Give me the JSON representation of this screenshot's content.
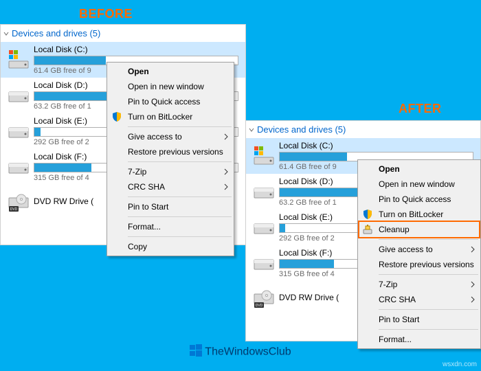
{
  "labels": {
    "before": "BEFORE",
    "after": "AFTER"
  },
  "section": {
    "title": "Devices and drives (5)"
  },
  "colors": {
    "accent": "#ff6a00",
    "link": "#0066cc",
    "bar": "#26a0da"
  },
  "drives_before": [
    {
      "name": "Local Disk (C:)",
      "free": "61.4 GB free of 9",
      "fill": 35,
      "type": "os",
      "selected": true
    },
    {
      "name": "Local Disk (D:)",
      "free": "63.2 GB free of 1",
      "fill": 55,
      "type": "hdd"
    },
    {
      "name": "Local Disk (E:)",
      "free": "292 GB free of 2",
      "fill": 3,
      "type": "hdd"
    },
    {
      "name": "Local Disk (F:)",
      "free": "315 GB free of 4",
      "fill": 28,
      "type": "hdd"
    },
    {
      "name": "DVD RW Drive (",
      "free": "",
      "fill": null,
      "type": "dvd"
    }
  ],
  "drives_after": [
    {
      "name": "Local Disk (C:)",
      "free": "61.4 GB free of 9",
      "fill": 35,
      "type": "os",
      "selected": true
    },
    {
      "name": "Local Disk (D:)",
      "free": "63.2 GB free of 1",
      "fill": 55,
      "type": "hdd"
    },
    {
      "name": "Local Disk (E:)",
      "free": "292 GB free of 2",
      "fill": 3,
      "type": "hdd"
    },
    {
      "name": "Local Disk (F:)",
      "free": "315 GB free of 4",
      "fill": 28,
      "type": "hdd"
    },
    {
      "name": "DVD RW Drive (",
      "free": "",
      "fill": null,
      "type": "dvd"
    }
  ],
  "menu_before": [
    {
      "label": "Open",
      "bold": true
    },
    {
      "label": "Open in new window"
    },
    {
      "label": "Pin to Quick access"
    },
    {
      "label": "Turn on BitLocker",
      "icon": "shield"
    },
    {
      "sep": true
    },
    {
      "label": "Give access to",
      "sub": true
    },
    {
      "label": "Restore previous versions"
    },
    {
      "sep": true
    },
    {
      "label": "7-Zip",
      "sub": true
    },
    {
      "label": "CRC SHA",
      "sub": true
    },
    {
      "sep": true
    },
    {
      "label": "Pin to Start"
    },
    {
      "sep": true
    },
    {
      "label": "Format..."
    },
    {
      "sep": true
    },
    {
      "label": "Copy"
    }
  ],
  "menu_after": [
    {
      "label": "Open",
      "bold": true
    },
    {
      "label": "Open in new window"
    },
    {
      "label": "Pin to Quick access"
    },
    {
      "label": "Turn on BitLocker",
      "icon": "shield"
    },
    {
      "label": "Cleanup",
      "icon": "cleanup",
      "highlight": true
    },
    {
      "sep": true
    },
    {
      "label": "Give access to",
      "sub": true
    },
    {
      "label": "Restore previous versions"
    },
    {
      "sep": true
    },
    {
      "label": "7-Zip",
      "sub": true
    },
    {
      "label": "CRC SHA",
      "sub": true
    },
    {
      "sep": true
    },
    {
      "label": "Pin to Start"
    },
    {
      "sep": true
    },
    {
      "label": "Format..."
    }
  ],
  "footer": {
    "text": "TheWindowsClub"
  },
  "watermark": "wsxdn.com"
}
